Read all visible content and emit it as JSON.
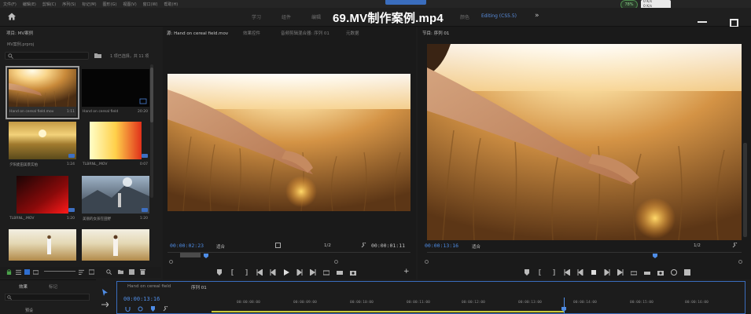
{
  "menubar": {
    "items": [
      "文件(F)",
      "编辑(E)",
      "剪辑(C)",
      "序列(S)",
      "标记(M)",
      "图形(G)",
      "视图(V)",
      "窗口(W)",
      "帮助(H)"
    ]
  },
  "system": {
    "badge": "78%",
    "net_up": "0 K/s",
    "net_down": "0 K/s"
  },
  "workspace": {
    "title": "69.MV制作案例.mp4",
    "items": [
      "学习",
      "组件",
      "编辑",
      "颜色",
      "效果",
      "音频",
      "图形",
      "Editing (CS5.5)"
    ],
    "more": "»"
  },
  "project": {
    "tab": "项目: MV案例",
    "file": "MV案例.prproj",
    "search_placeholder": "",
    "selection": "1 项已选择，共 11 项",
    "clips": [
      {
        "label": "Hand on cereal field.mov",
        "duration": "1:11"
      },
      {
        "label": "Hand on cereal field",
        "duration": "20:20"
      },
      {
        "label": "夕阳麦田美景实拍",
        "duration": "1:24"
      },
      {
        "label": "TLBRNL_.MOV",
        "duration": "0:07"
      },
      {
        "label": "TLBRNL_.MOV",
        "duration": "1:20"
      },
      {
        "label": "美丽的女孩在田野",
        "duration": "1:20"
      },
      {
        "label": "",
        "duration": ""
      },
      {
        "label": "",
        "duration": ""
      }
    ]
  },
  "source": {
    "tabs": [
      "源: Hand on cereal field.mov",
      "效果控件",
      "音频剪辑混合器: 序列 01",
      "元数据"
    ],
    "timecode_in": "00:00:02:23",
    "fit": "适合",
    "fraction": "1/2",
    "duration": "00:00:01:11"
  },
  "program": {
    "tab": "节目: 序列 01",
    "timecode": "00:00:13:16",
    "fit": "适合",
    "fraction": "1/2"
  },
  "bottom_left": {
    "tabs": [
      "效果",
      "标记"
    ],
    "item": "预设"
  },
  "timeline": {
    "tab_source": "Hand on cereal field",
    "tab_sequence": "序列 01",
    "timecode": "00:00:13:16",
    "ticks": [
      "00:00:08:00",
      "00:00:09:00",
      "00:00:10:00",
      "00:00:11:00",
      "00:00:12:00",
      "00:00:13:00",
      "00:00:14:00",
      "00:00:15:00",
      "00:00:16:00"
    ]
  },
  "colors": {
    "accent": "#4f8de6",
    "bg": "#1d1d1d"
  }
}
